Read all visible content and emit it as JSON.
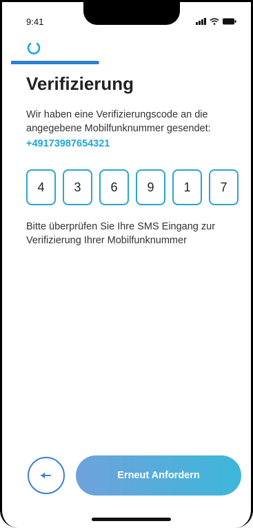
{
  "status_bar": {
    "time": "9:41",
    "icons": [
      "signal-icon",
      "wifi-icon",
      "battery-icon"
    ]
  },
  "header": {
    "logo_icon": "power-ring-icon",
    "progress": 0.33
  },
  "main": {
    "title": "Verifizierung",
    "description": "Wir haben eine Verifizierungscode an die angegebene Mobilfunknummer gesendet:",
    "phone_number": "+49173987654321",
    "code_digits": [
      "4",
      "3",
      "6",
      "9",
      "1",
      "7"
    ],
    "note": "Bitte überprüfen Sie Ihre SMS Eingang zur Verifizierung Ihrer Mobilfunknummer"
  },
  "footer": {
    "back_icon": "arrow-left-icon",
    "resend_label": "Erneut Anfordern"
  },
  "colors": {
    "accent": "#1ea6d6",
    "border": "#2aa5d1",
    "progress": "#2a7fd8",
    "button_gradient_start": "#6fa2dc",
    "button_gradient_end": "#3cb7d9"
  }
}
